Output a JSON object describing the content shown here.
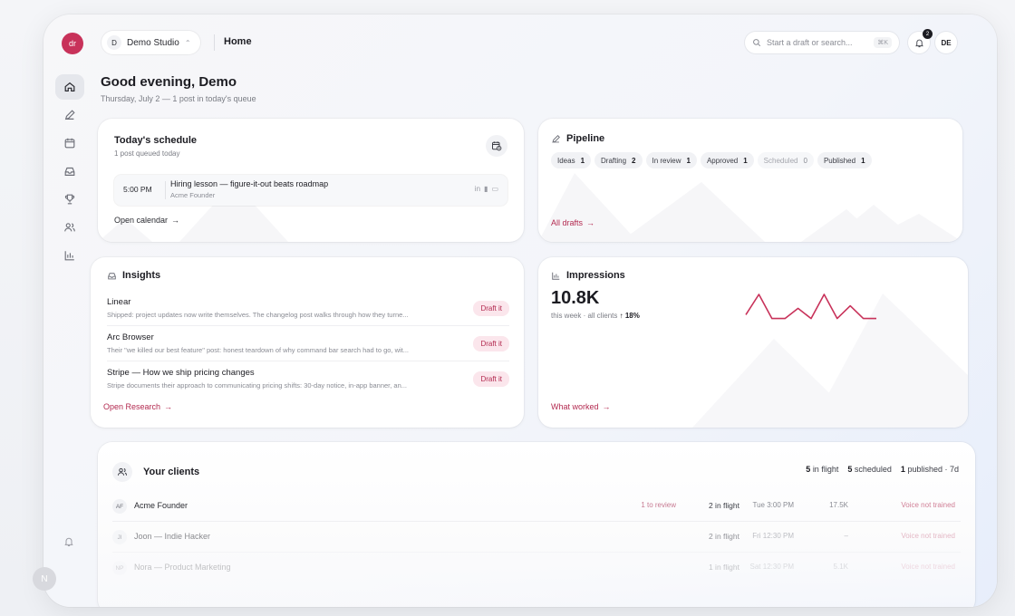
{
  "sidebar": {
    "logo_text": "dr",
    "items": [
      {
        "icon": "home-icon",
        "active": true
      },
      {
        "icon": "pen-icon"
      },
      {
        "icon": "calendar-icon"
      },
      {
        "icon": "inbox-icon"
      },
      {
        "icon": "trophy-icon"
      },
      {
        "icon": "users-icon"
      },
      {
        "icon": "chart-icon"
      }
    ],
    "avatar_initial": "N"
  },
  "header": {
    "studio_initial": "D",
    "studio_name": "Demo Studio",
    "title": "Home",
    "search_placeholder": "Start a draft or search...",
    "search_shortcut": "⌘K",
    "notification_count": "2",
    "user_initials": "DE"
  },
  "greeting": {
    "title": "Good evening, Demo",
    "subtitle": "Thursday, July 2 — 1 post in today's queue"
  },
  "schedule": {
    "title": "Today's schedule",
    "subtitle": "1 post queued today",
    "item": {
      "time": "5:00 PM",
      "title": "Hiring lesson — figure-it-out beats roadmap",
      "client": "Acme Founder"
    },
    "link": "Open calendar"
  },
  "pipeline": {
    "title": "Pipeline",
    "stages": [
      {
        "label": "Ideas",
        "count": "1"
      },
      {
        "label": "Drafting",
        "count": "2"
      },
      {
        "label": "In review",
        "count": "1"
      },
      {
        "label": "Approved",
        "count": "1"
      },
      {
        "label": "Scheduled",
        "count": "0",
        "muted": true
      },
      {
        "label": "Published",
        "count": "1"
      }
    ],
    "link": "All drafts"
  },
  "insights": {
    "title": "Insights",
    "items": [
      {
        "name": "Linear",
        "desc": "Shipped: project updates now write themselves. The changelog post walks through how they turne...",
        "action": "Draft it"
      },
      {
        "name": "Arc Browser",
        "desc": "Their \"we killed our best feature\" post: honest teardown of why command bar search had to go, wit...",
        "action": "Draft it"
      },
      {
        "name": "Stripe — How we ship pricing changes",
        "desc": "Stripe documents their approach to communicating pricing shifts: 30-day notice, in-app banner, an...",
        "action": "Draft it"
      }
    ],
    "link": "Open Research"
  },
  "impressions": {
    "title": "Impressions",
    "value": "10.8K",
    "subtitle": "this week · all clients",
    "delta": "↑ 18%",
    "trend": [
      0.2,
      1.0,
      0.05,
      0.05,
      0.45,
      0.05,
      1.0,
      0.05,
      0.55,
      0.05,
      0.05
    ],
    "line_color": "#c8325a",
    "link": "What worked"
  },
  "clients": {
    "title": "Your clients",
    "stats": [
      {
        "value": "5",
        "label": "in flight"
      },
      {
        "value": "5",
        "label": "scheduled"
      },
      {
        "value": "1",
        "label": "published · 7d"
      }
    ],
    "rows": [
      {
        "initials": "AF",
        "name": "Acme Founder",
        "review": "1 to review",
        "flight": "2 in flight",
        "when": "Tue 3:00 PM",
        "metrics": "17.5K",
        "voice": "Voice not trained"
      },
      {
        "initials": "JI",
        "name": "Joon — Indie Hacker",
        "review": "",
        "flight": "2 in flight",
        "when": "Fri 12:30 PM",
        "metrics": "–",
        "voice": "Voice not trained"
      },
      {
        "initials": "NP",
        "name": "Nora — Product Marketing",
        "review": "",
        "flight": "1 in flight",
        "when": "Sat 12:30 PM",
        "metrics": "5.1K",
        "voice": "Voice not trained"
      }
    ]
  },
  "colors": {
    "accent": "#c8325a",
    "accent_soft": "#fbe6ec"
  }
}
